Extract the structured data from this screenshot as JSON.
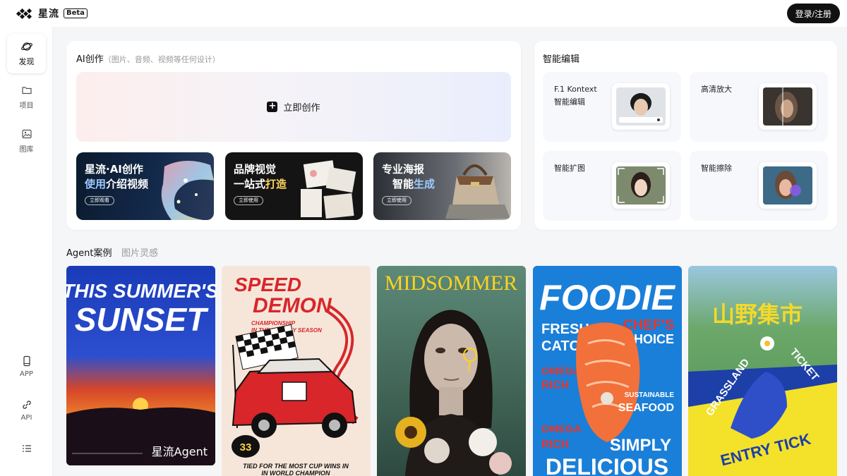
{
  "header": {
    "logo_text": "星流",
    "beta": "Beta",
    "login_label": "登录/注册"
  },
  "sidebar": {
    "items": [
      {
        "label": "发现",
        "icon": "planet-icon"
      },
      {
        "label": "项目",
        "icon": "folder-icon"
      },
      {
        "label": "图库",
        "icon": "image-icon"
      },
      {
        "label": "APP",
        "icon": "phone-icon"
      },
      {
        "label": "API",
        "icon": "link-icon"
      }
    ],
    "menu_icon": "menu-icon"
  },
  "ai_create": {
    "title": "AI创作",
    "subtitle": "（图片、音频、视频等任何设计）",
    "create_label": "立即创作",
    "promos": [
      {
        "line1": "星流·AI创作",
        "line2_a": "使用",
        "line2_hl": "介绍视频",
        "button": "立即观看"
      },
      {
        "line1": "品牌视觉",
        "line2_a": "一站式",
        "line2_hl": "打造",
        "button": "立即使用"
      },
      {
        "line1": "专业海报",
        "line2_a": "智能",
        "line2_hl": "生成",
        "button": "立即使用"
      }
    ]
  },
  "smart_edit": {
    "title": "智能编辑",
    "tiles": [
      {
        "line1": "F.1 Kontext",
        "line2": "智能编辑"
      },
      {
        "line1": "高清放大",
        "line2": ""
      },
      {
        "line1": "智能扩图",
        "line2": ""
      },
      {
        "line1": "智能擦除",
        "line2": ""
      }
    ]
  },
  "tabs": {
    "agent": "Agent案例",
    "inspiration": "图片灵感"
  },
  "gallery": [
    {
      "title1": "THIS SUMMER'S",
      "title2": "SUNSET",
      "brand": "星流Agent"
    },
    {
      "title1": "SPEED",
      "title2": "DEMON",
      "sub1": "CHAMPIONSHIP",
      "sub2": "IN THE HOLIDAY SEASON",
      "badge": "33",
      "foot1": "TIED FOR THE MOST CUP WINS IN",
      "foot2": "IN WORLD CHAMPION"
    },
    {
      "title1": "MIDSOMMER"
    },
    {
      "title1": "FOODIE",
      "left1": "FRESH",
      "left2": "CATCH",
      "right1": "CHEF'S",
      "right2": "CHOICE",
      "omega1": "OMEGA",
      "rich1": "RICH",
      "omega2": "OMEGA",
      "rich2": "RICH",
      "sus1": "SUSTAINABLE",
      "sus2": "SEAFOOD",
      "foot1": "SIMPLY",
      "foot2": "DELICIOUS"
    },
    {
      "title1": "山野集市",
      "arc1": "GRASSLAND",
      "arc2": "TICKET",
      "foot1": "ENTRY TICK"
    }
  ],
  "colors": {
    "accent_dark": "#111111",
    "highlight_blue": "#9ec9ff",
    "page_bg": "#f5f6f8"
  }
}
